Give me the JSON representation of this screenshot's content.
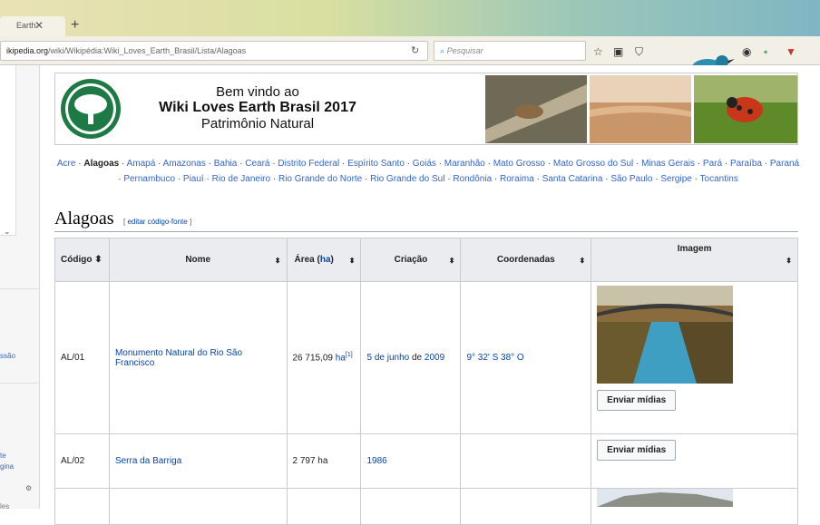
{
  "browser": {
    "tab_title": "Earth",
    "url_host": "ikipedia.org",
    "url_path": "/wiki/Wikipédia:Wiki_Loves_Earth_Brasil/Lista/Alagoas",
    "search_placeholder": "Pesquisar"
  },
  "sidebar": {
    "text1": "ssão",
    "text2": "te",
    "text3": "gina",
    "text4": "les"
  },
  "banner": {
    "line1": "Bem vindo ao",
    "line2": "Wiki Loves Earth Brasil 2017",
    "line3": "Patrimônio Natural"
  },
  "regions": [
    "Acre",
    "Alagoas",
    "Amapá",
    "Amazonas",
    "Bahia",
    "Ceará",
    "Distrito Federal",
    "Espírito Santo",
    "Goiás",
    "Maranhão",
    "Mato Grosso",
    "Mato Grosso do Sul",
    "Minas Gerais",
    "Pará",
    "Paraíba",
    "Paraná",
    "Pernambuco",
    "Piauí",
    "Rio de Janeiro",
    "Rio Grande do Norte",
    "Rio Grande do Sul",
    "Rondônia",
    "Roraima",
    "Santa Catarina",
    "São Paulo",
    "Sergipe",
    "Tocantins"
  ],
  "section": {
    "title": "Alagoas",
    "edit_open": "[ ",
    "edit_link": "editar código-fonte",
    "edit_close": " ]"
  },
  "table": {
    "headers": {
      "codigo": "Código",
      "nome": "Nome",
      "area": "Área (",
      "area_unit": "ha",
      "area_close": ")",
      "criacao": "Criação",
      "coordenadas": "Coordenadas",
      "imagem": "Imagem"
    },
    "rows": [
      {
        "codigo": "AL/01",
        "nome": "Monumento Natural do Rio São Francisco",
        "area": "26 715,09 ",
        "area_unit": "ha",
        "ref": "[1]",
        "criacao_a": "5 de junho",
        "criacao_b": " de ",
        "criacao_c": "2009",
        "coord": "9° 32' S 38° O",
        "button": "Enviar mídias"
      },
      {
        "codigo": "AL/02",
        "nome": "Serra da Barriga",
        "area": "2 797 ha",
        "criacao": "1986",
        "coord": "",
        "button": "Enviar mídias"
      }
    ]
  }
}
